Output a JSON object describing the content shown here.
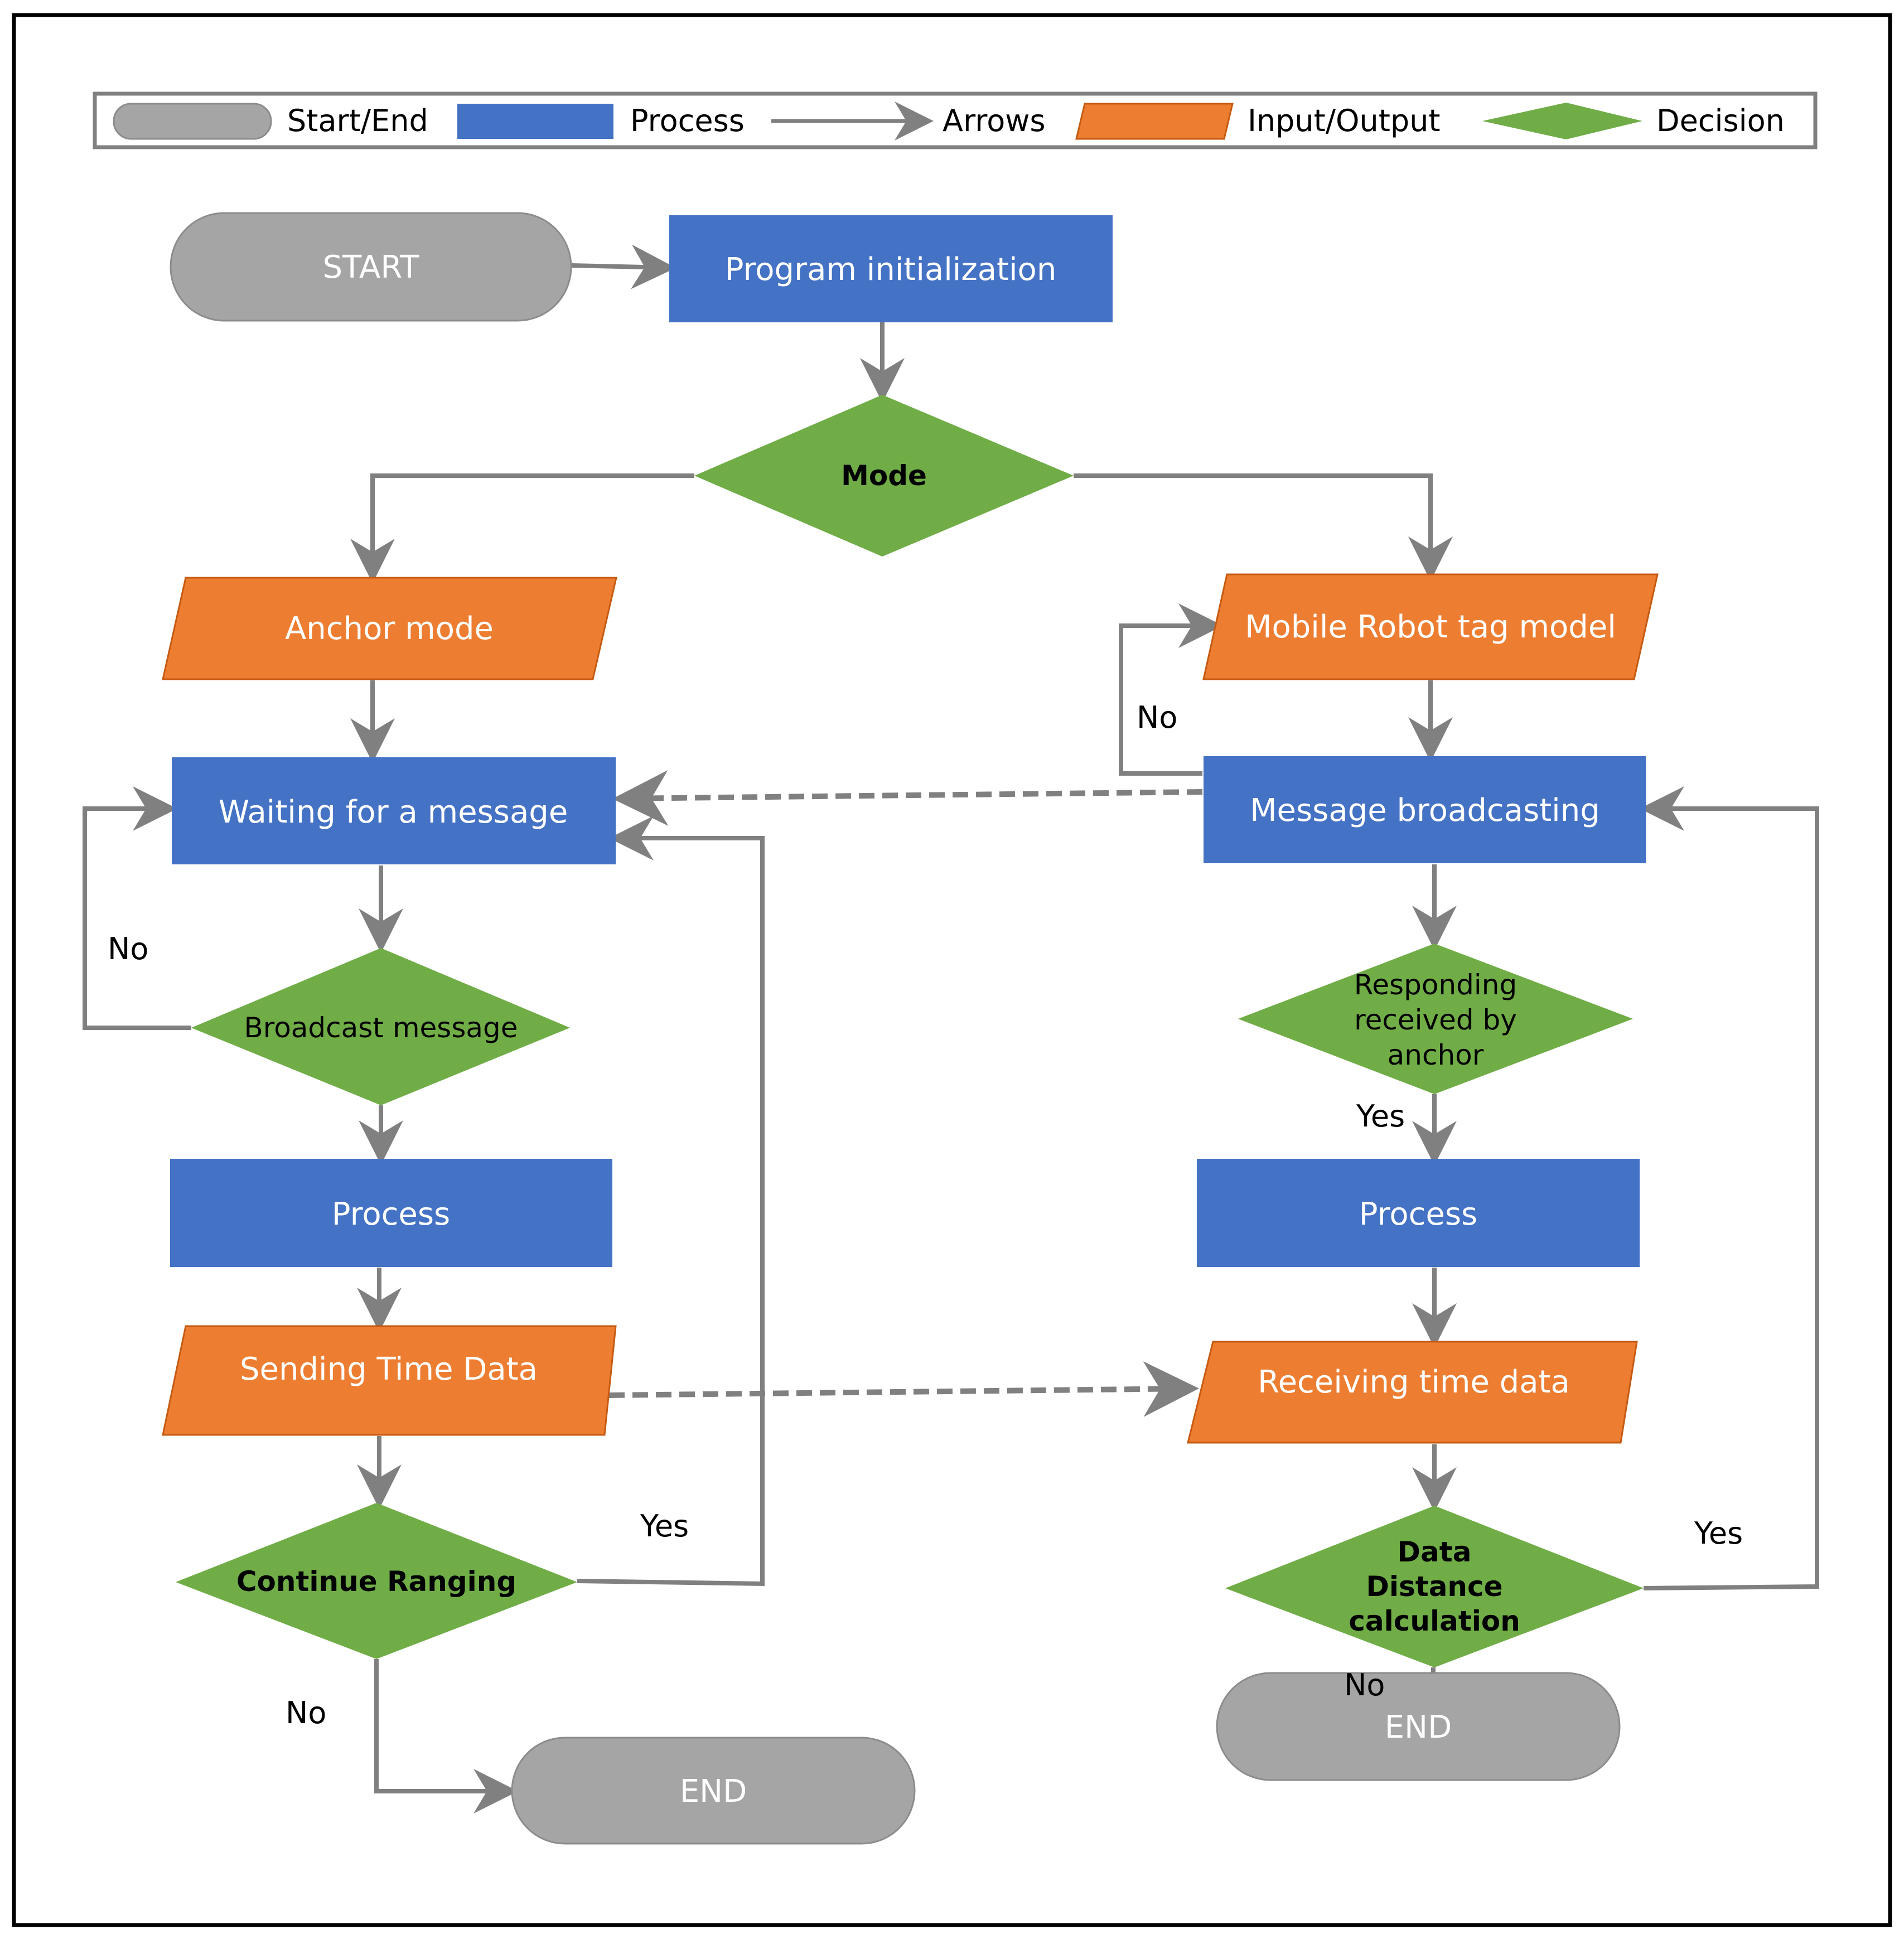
{
  "colors": {
    "terminal": "#a5a5a5",
    "terminal_stroke": "#8c8c8c",
    "process": "#4472c4",
    "io": "#ed7d31",
    "io_stroke": "#c55a11",
    "decision": "#70ad47",
    "arrow": "#808080",
    "frame": "#000000",
    "legend_border": "#808080"
  },
  "legend": {
    "items": [
      {
        "shape": "terminal",
        "label": "Start/End"
      },
      {
        "shape": "process",
        "label": "Process"
      },
      {
        "shape": "arrow",
        "label": "Arrows"
      },
      {
        "shape": "io",
        "label": "Input/Output"
      },
      {
        "shape": "decision",
        "label": "Decision"
      }
    ]
  },
  "nodes": {
    "start": {
      "type": "terminal",
      "label": "START"
    },
    "program_init": {
      "type": "process",
      "label": "Program initialization"
    },
    "mode": {
      "type": "decision",
      "lines": [
        "Mode"
      ],
      "bold": true
    },
    "anchor_mode": {
      "type": "io",
      "label": "Anchor mode"
    },
    "tag_mode": {
      "type": "io",
      "label": "Mobile Robot tag model"
    },
    "waiting": {
      "type": "process",
      "label": "Waiting for a message"
    },
    "broadcasting": {
      "type": "process",
      "label": "Message broadcasting"
    },
    "broadcast_msg": {
      "type": "decision",
      "lines": [
        "Broadcast message"
      ],
      "bold": false
    },
    "responding": {
      "type": "decision",
      "lines": [
        "Responding",
        "received by",
        "anchor"
      ],
      "bold": false
    },
    "process_left": {
      "type": "process",
      "label": "Process"
    },
    "process_right": {
      "type": "process",
      "label": "Process"
    },
    "sending": {
      "type": "io",
      "label": "Sending Time Data"
    },
    "receiving": {
      "type": "io",
      "label": "Receiving time data"
    },
    "continue_ranging": {
      "type": "decision",
      "lines": [
        "Continue Ranging"
      ],
      "bold": true
    },
    "distance_calc": {
      "type": "decision",
      "lines": [
        "Data",
        "Distance",
        "calculation"
      ],
      "bold": true
    },
    "end_left": {
      "type": "terminal",
      "label": "END"
    },
    "end_right": {
      "type": "terminal",
      "label": "END"
    }
  },
  "edge_labels": {
    "tag_no": "No",
    "broadcast_no": "No",
    "responding_yes": "Yes",
    "continue_yes": "Yes",
    "continue_no": "No",
    "distance_yes": "Yes",
    "distance_no": "No"
  },
  "edges": [
    {
      "from": "start",
      "to": "program_init",
      "style": "solid"
    },
    {
      "from": "program_init",
      "to": "mode",
      "style": "solid"
    },
    {
      "from": "mode",
      "to": "anchor_mode",
      "style": "solid"
    },
    {
      "from": "mode",
      "to": "tag_mode",
      "style": "solid"
    },
    {
      "from": "anchor_mode",
      "to": "waiting",
      "style": "solid"
    },
    {
      "from": "waiting",
      "to": "broadcast_msg",
      "style": "solid"
    },
    {
      "from": "broadcast_msg",
      "to": "waiting",
      "style": "solid",
      "label": "No"
    },
    {
      "from": "broadcast_msg",
      "to": "process_left",
      "style": "solid"
    },
    {
      "from": "process_left",
      "to": "sending",
      "style": "solid"
    },
    {
      "from": "sending",
      "to": "continue_ranging",
      "style": "solid"
    },
    {
      "from": "continue_ranging",
      "to": "waiting",
      "style": "solid",
      "label": "Yes"
    },
    {
      "from": "continue_ranging",
      "to": "end_left",
      "style": "solid",
      "label": "No"
    },
    {
      "from": "tag_mode",
      "to": "broadcasting",
      "style": "solid"
    },
    {
      "from": "broadcasting",
      "to": "tag_mode",
      "style": "solid",
      "label": "No"
    },
    {
      "from": "broadcasting",
      "to": "waiting",
      "style": "dashed"
    },
    {
      "from": "broadcasting",
      "to": "responding",
      "style": "solid"
    },
    {
      "from": "responding",
      "to": "process_right",
      "style": "solid",
      "label": "Yes"
    },
    {
      "from": "process_right",
      "to": "receiving",
      "style": "solid"
    },
    {
      "from": "sending",
      "to": "receiving",
      "style": "dashed"
    },
    {
      "from": "receiving",
      "to": "distance_calc",
      "style": "solid"
    },
    {
      "from": "distance_calc",
      "to": "broadcasting",
      "style": "solid",
      "label": "Yes"
    },
    {
      "from": "distance_calc",
      "to": "end_right",
      "style": "solid",
      "label": "No"
    }
  ]
}
